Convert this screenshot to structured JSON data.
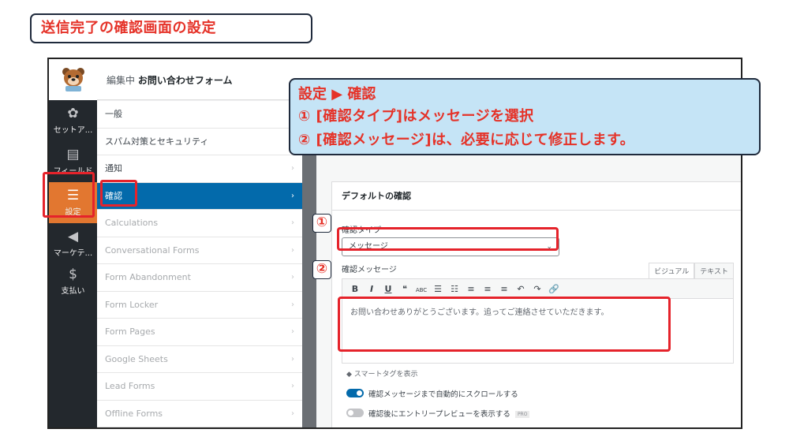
{
  "page_title": "送信完了の確認画面の設定",
  "callout": {
    "line1": "設定 ▶ 確認",
    "line2": "① [確認タイプ]はメッセージを選択",
    "line3": "② [確認メッセージ]は、必要に応じて修正します。"
  },
  "header": {
    "editing_prefix": "編集中",
    "form_name": "お問い合わせフォーム"
  },
  "wp_sidebar": [
    {
      "icon": "gear-icon",
      "glyph": "✿",
      "label": "セットア..."
    },
    {
      "icon": "fields-icon",
      "glyph": "▤",
      "label": "フィールド"
    },
    {
      "icon": "settings-sliders-icon",
      "glyph": "☰",
      "label": "設定"
    },
    {
      "icon": "megaphone-icon",
      "glyph": "◀",
      "label": "マーケテ..."
    },
    {
      "icon": "dollar-icon",
      "glyph": "$",
      "label": "支払い"
    }
  ],
  "subnav": [
    {
      "label": "一般",
      "state": "normal"
    },
    {
      "label": "スパム対策とセキュリティ",
      "state": "normal"
    },
    {
      "label": "通知",
      "state": "normal"
    },
    {
      "label": "確認",
      "state": "active"
    },
    {
      "label": "Calculations",
      "state": "dim"
    },
    {
      "label": "Conversational Forms",
      "state": "dim"
    },
    {
      "label": "Form Abandonment",
      "state": "dim"
    },
    {
      "label": "Form Locker",
      "state": "dim"
    },
    {
      "label": "Form Pages",
      "state": "dim"
    },
    {
      "label": "Google Sheets",
      "state": "dim"
    },
    {
      "label": "Lead Forms",
      "state": "dim"
    },
    {
      "label": "Offline Forms",
      "state": "dim"
    }
  ],
  "panel": {
    "title": "デフォルトの確認",
    "type_label": "確認タイプ",
    "type_value": "メッセージ",
    "message_label": "確認メッセージ",
    "tab_visual": "ビジュアル",
    "tab_text": "テキスト",
    "toolbar": [
      "B",
      "I",
      "U",
      "❝",
      "ABC",
      "☰",
      "☷",
      "≡",
      "≡",
      "≡",
      "↶",
      "↷",
      "🔗"
    ],
    "message_body": "お問い合わせありがとうございます。追ってご連絡させていただきます。",
    "smart_tag": "スマートタグを表示",
    "toggle1_label": "確認メッセージまで自動的にスクロールする",
    "toggle2_label": "確認後にエントリープレビューを表示する",
    "pro_badge": "PRO"
  },
  "markers": {
    "one": "①",
    "two": "②"
  },
  "colors": {
    "accent_red": "#e53228",
    "nav_active": "#036aab",
    "sidebar_active": "#e27730",
    "callout_bg": "#c5e4f6"
  }
}
